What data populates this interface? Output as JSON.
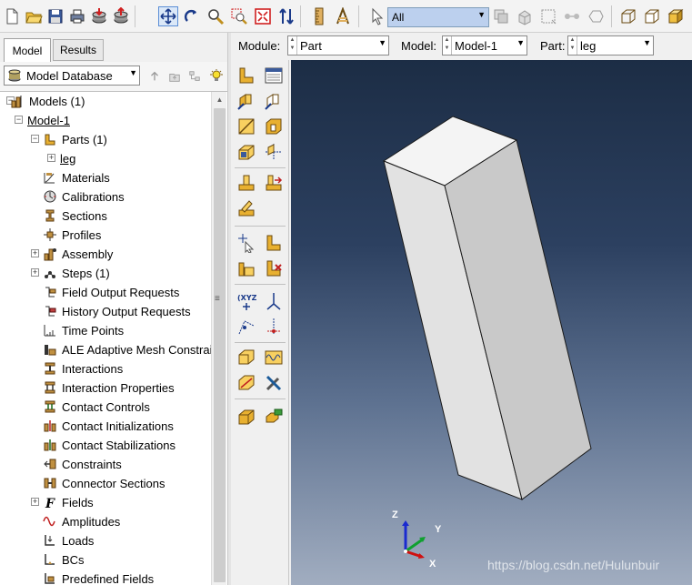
{
  "toolbar": {
    "icons": [
      "new-file-icon",
      "open-folder-icon",
      "save-icon",
      "print-icon",
      "import-icon",
      "export-icon",
      "pan-icon",
      "rotate-icon",
      "magnify-icon",
      "box-zoom-icon",
      "auto-fit-icon",
      "cycle-views-icon",
      "ruler-icon",
      "measure-icon",
      "select-arrow-icon",
      "selection-filter",
      "copy-icon",
      "replace-icon",
      "box-select-icon",
      "node-select-icon",
      "polygon-icon",
      "wireframe-icon",
      "hidden-line-icon",
      "shaded-icon"
    ],
    "selection_filter": "All"
  },
  "tabs": {
    "model": "Model",
    "results": "Results"
  },
  "model_db": {
    "label": "Model Database"
  },
  "tree": {
    "items": [
      {
        "label": "Models (1)",
        "icon": "models-icon"
      },
      {
        "label": "Model-1",
        "icon": ""
      },
      {
        "label": "Parts (1)",
        "icon": "part-icon"
      },
      {
        "label": "leg",
        "icon": ""
      },
      {
        "label": "Materials",
        "icon": "material-icon"
      },
      {
        "label": "Calibrations",
        "icon": "calibration-icon"
      },
      {
        "label": "Sections",
        "icon": "section-icon"
      },
      {
        "label": "Profiles",
        "icon": "profile-icon"
      },
      {
        "label": "Assembly",
        "icon": "assembly-icon"
      },
      {
        "label": "Steps (1)",
        "icon": "steps-icon"
      },
      {
        "label": "Field Output Requests",
        "icon": "field-output-icon"
      },
      {
        "label": "History Output Requests",
        "icon": "history-output-icon"
      },
      {
        "label": "Time Points",
        "icon": "time-points-icon"
      },
      {
        "label": "ALE Adaptive Mesh Constraints",
        "icon": "ale-icon"
      },
      {
        "label": "Interactions",
        "icon": "interaction-icon"
      },
      {
        "label": "Interaction Properties",
        "icon": "interaction-property-icon"
      },
      {
        "label": "Contact Controls",
        "icon": "contact-controls-icon"
      },
      {
        "label": "Contact Initializations",
        "icon": "contact-init-icon"
      },
      {
        "label": "Contact Stabilizations",
        "icon": "contact-stab-icon"
      },
      {
        "label": "Constraints",
        "icon": "constraint-icon"
      },
      {
        "label": "Connector Sections",
        "icon": "connector-icon"
      },
      {
        "label": "Fields",
        "icon": "fields-icon"
      },
      {
        "label": "Amplitudes",
        "icon": "amplitude-icon"
      },
      {
        "label": "Loads",
        "icon": "load-icon"
      },
      {
        "label": "BCs",
        "icon": "bc-icon"
      },
      {
        "label": "Predefined Fields",
        "icon": "predefined-field-icon"
      }
    ]
  },
  "context": {
    "module_label": "Module:",
    "module_value": "Part",
    "model_label": "Model:",
    "model_value": "Model-1",
    "part_label": "Part:",
    "part_value": "leg"
  },
  "viewport": {
    "triad_x": "X",
    "triad_y": "Y",
    "triad_z": "Z",
    "watermark": "https://blog.csdn.net/Hulunbuir"
  },
  "colors": {
    "viewport_top": "#1c2d45",
    "viewport_bottom": "#a1adc0",
    "part_face": "#d8d8d8",
    "selection_highlight": "#bcd0ee"
  }
}
